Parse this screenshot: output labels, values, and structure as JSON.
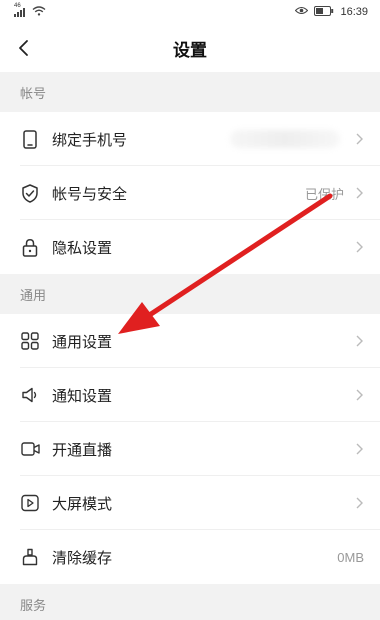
{
  "status_bar": {
    "signal_badge": "46",
    "time": "16:39"
  },
  "nav": {
    "title": "设置"
  },
  "sections": {
    "account": {
      "header": "帐号",
      "items": [
        {
          "label": "绑定手机号",
          "value": "",
          "icon": "phone-icon"
        },
        {
          "label": "帐号与安全",
          "value": "已保护",
          "icon": "shield-check-icon"
        },
        {
          "label": "隐私设置",
          "value": "",
          "icon": "lock-icon"
        }
      ]
    },
    "general": {
      "header": "通用",
      "items": [
        {
          "label": "通用设置",
          "value": "",
          "icon": "grid-icon"
        },
        {
          "label": "通知设置",
          "value": "",
          "icon": "speaker-icon"
        },
        {
          "label": "开通直播",
          "value": "",
          "icon": "video-camera-icon"
        },
        {
          "label": "大屏模式",
          "value": "",
          "icon": "play-screen-icon"
        },
        {
          "label": "清除缓存",
          "value": "0MB",
          "icon": "broom-icon"
        }
      ]
    },
    "service": {
      "header": "服务"
    }
  },
  "colors": {
    "annotation": "#e02020",
    "section_bg": "#f2f2f2"
  }
}
